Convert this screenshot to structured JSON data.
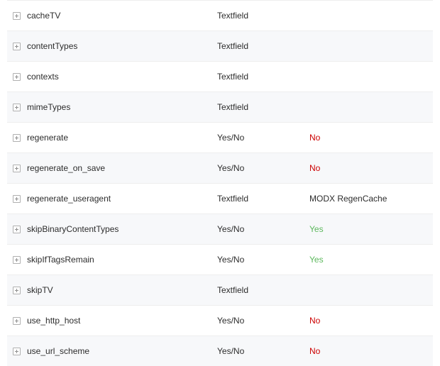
{
  "settings": [
    {
      "name": "cacheTV",
      "type": "Textfield",
      "value": "",
      "value_kind": ""
    },
    {
      "name": "contentTypes",
      "type": "Textfield",
      "value": "",
      "value_kind": ""
    },
    {
      "name": "contexts",
      "type": "Textfield",
      "value": "",
      "value_kind": ""
    },
    {
      "name": "mimeTypes",
      "type": "Textfield",
      "value": "",
      "value_kind": ""
    },
    {
      "name": "regenerate",
      "type": "Yes/No",
      "value": "No",
      "value_kind": "no"
    },
    {
      "name": "regenerate_on_save",
      "type": "Yes/No",
      "value": "No",
      "value_kind": "no"
    },
    {
      "name": "regenerate_useragent",
      "type": "Textfield",
      "value": "MODX RegenCache",
      "value_kind": ""
    },
    {
      "name": "skipBinaryContentTypes",
      "type": "Yes/No",
      "value": "Yes",
      "value_kind": "yes"
    },
    {
      "name": "skipIfTagsRemain",
      "type": "Yes/No",
      "value": "Yes",
      "value_kind": "yes"
    },
    {
      "name": "skipTV",
      "type": "Textfield",
      "value": "",
      "value_kind": ""
    },
    {
      "name": "use_http_host",
      "type": "Yes/No",
      "value": "No",
      "value_kind": "no"
    },
    {
      "name": "use_url_scheme",
      "type": "Yes/No",
      "value": "No",
      "value_kind": "no"
    }
  ]
}
